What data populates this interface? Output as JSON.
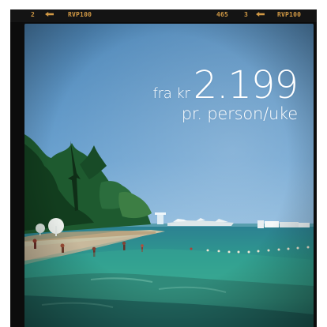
{
  "film_strip": {
    "left_frame_number": "2",
    "left_film_label": "RVP100",
    "center_counter": "465",
    "right_frame_number": "3",
    "right_film_label": "RVP100"
  },
  "offer": {
    "prefix": "fra kr",
    "price": "2.199",
    "suffix": "pr. person/uke"
  },
  "colors": {
    "film_text": "#d39a45",
    "sky_top": "#4f87b8",
    "water": "#2a8f88",
    "text": "#ffffff"
  },
  "icons": {
    "arrow_left": "arrow-left-icon",
    "arrow_right": "arrow-left-icon"
  }
}
